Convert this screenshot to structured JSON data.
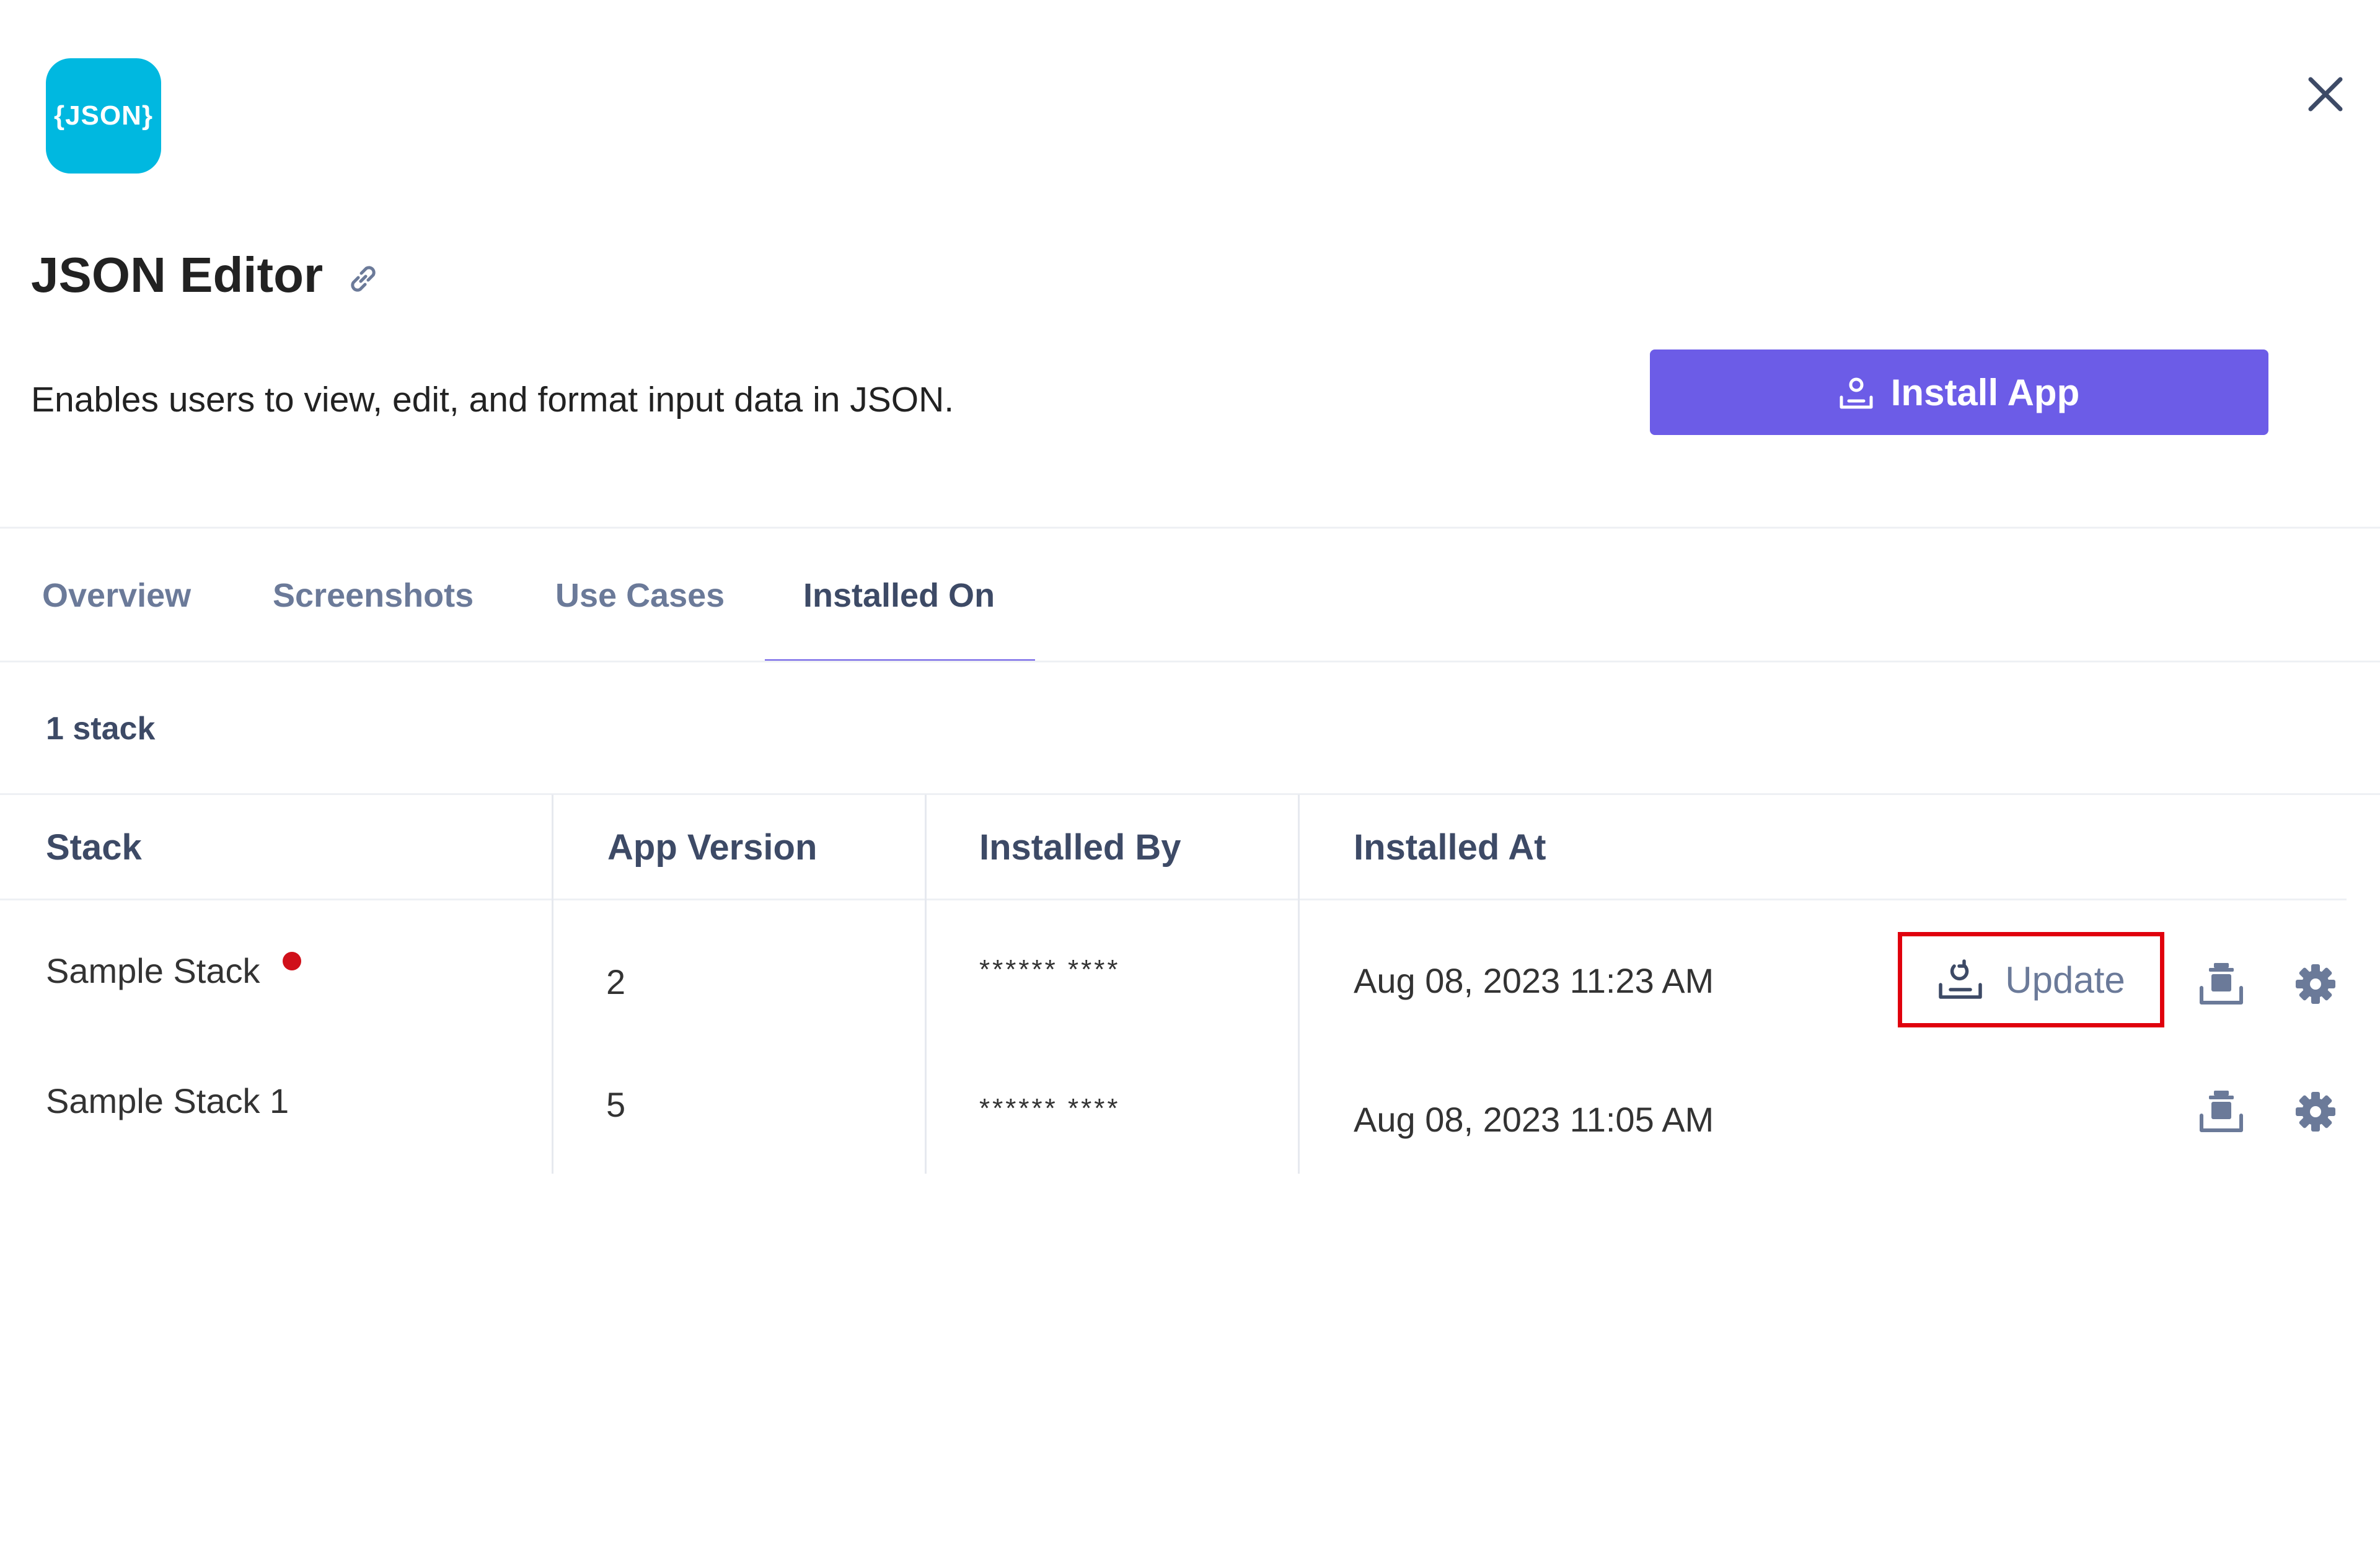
{
  "app": {
    "icon_text": "{JSON}",
    "title": "JSON Editor",
    "description": "Enables users to view, edit, and format input data in JSON.",
    "install_label": "Install App",
    "brand_color": "#00b8e0",
    "accent_color": "#6c5ce7"
  },
  "icons": {
    "close": "close-icon",
    "link": "link-icon",
    "install": "install-icon",
    "update": "update-icon",
    "uninstall": "uninstall-icon",
    "settings": "gear-icon"
  },
  "tabs": [
    {
      "label": "Overview",
      "active": false
    },
    {
      "label": "Screenshots",
      "active": false
    },
    {
      "label": "Use Cases",
      "active": false
    },
    {
      "label": "Installed On",
      "active": true
    }
  ],
  "stack_count": "1 stack",
  "table": {
    "headers": [
      "Stack",
      "App Version",
      "Installed By",
      "Installed At"
    ],
    "rows": [
      {
        "stack": "Sample Stack",
        "version": "2",
        "installed_by": "****** ****",
        "installed_at": "Aug 08, 2023 11:23 AM",
        "update_available": true,
        "update_label": "Update"
      },
      {
        "stack": "Sample Stack 1",
        "version": "5",
        "installed_by": "****** ****",
        "installed_at": "Aug 08, 2023 11:05 AM",
        "update_available": false
      }
    ]
  },
  "highlight_color": "#e0000d",
  "status_dot_color": "#d0101a"
}
